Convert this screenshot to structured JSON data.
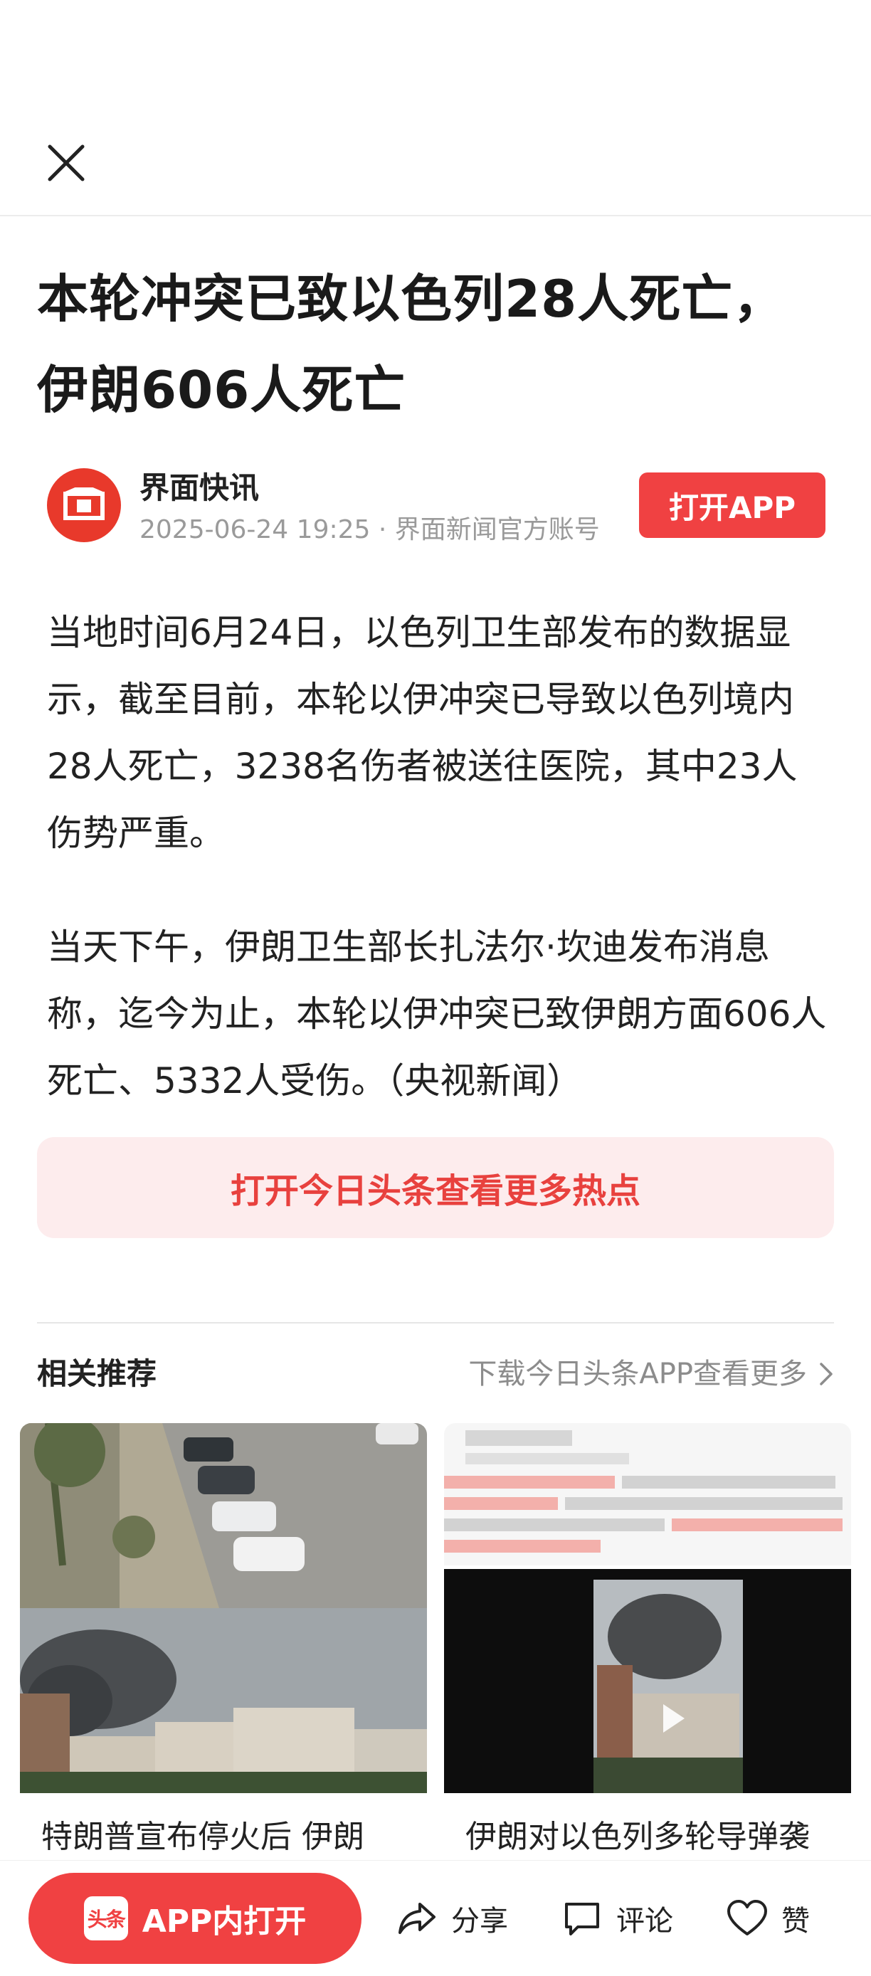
{
  "article": {
    "title_line1": "本轮冲突已致以色列28人死亡，",
    "title_line2": "伊朗606人死亡",
    "author_name": "界面快讯",
    "author_meta": "2025-06-24 19:25 · 界面新闻官方账号",
    "open_app_label": "打开APP",
    "paragraphs": [
      "当地时间6月24日，以色列卫生部发布的数据显示，截至目前，本轮以伊冲突已导致以色列境内28人死亡，3238名伤者被送往医院，其中23人伤势严重。",
      "当天下午，伊朗卫生部长扎法尔·坎迪发布消息称，迄今为止，本轮以伊冲突已致伊朗方面606人死亡、5332人受伤。（央视新闻）"
    ],
    "more_banner": "打开今日头条查看更多热点"
  },
  "related": {
    "title": "相关推荐",
    "more_label": "下载今日头条APP查看更多",
    "cards": [
      {
        "title": "特朗普宣布停火后 伊朗"
      },
      {
        "title": "伊朗对以色列多轮导弹袭"
      }
    ]
  },
  "toolbar": {
    "app_logo": "头条",
    "app_open_label": "APP内打开",
    "share_label": "分享",
    "comment_label": "评论",
    "like_label": "赞"
  },
  "colors": {
    "accent": "#f04142",
    "banner_bg": "#fdeced",
    "meta_gray": "#9a9a9a"
  },
  "icons": [
    "close-icon",
    "jiemian-logo-icon",
    "chevron-right-icon",
    "share-icon",
    "comment-icon",
    "heart-icon",
    "toutiao-logo-icon",
    "play-icon"
  ]
}
